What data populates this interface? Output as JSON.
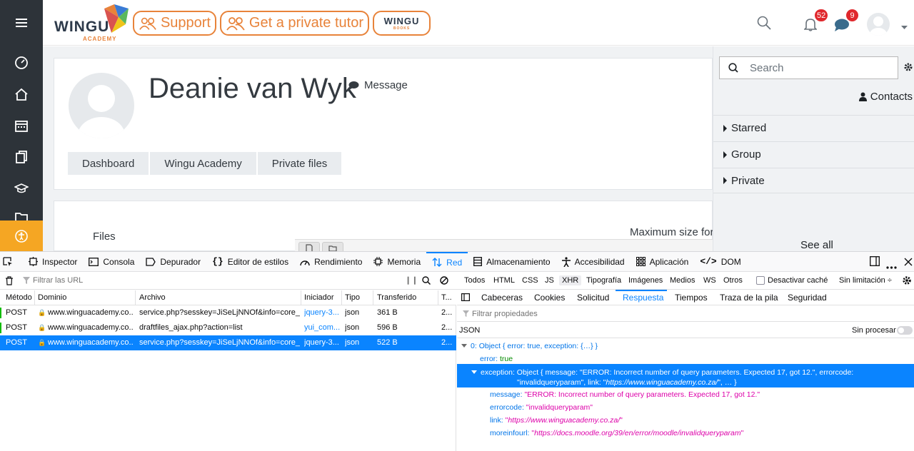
{
  "header": {
    "logo_text": "WINGU",
    "logo_sub": "ACADEMY",
    "support_label": "Support",
    "tutor_label": "Get a private tutor",
    "books_logo_text": "WINGU",
    "books_logo_sub": "BOOKS",
    "notifications_count": "52",
    "messages_count": "9"
  },
  "profile": {
    "name": "Deanie van Wyk",
    "message_label": "Message"
  },
  "breadcrumb": [
    "Dashboard",
    "Wingu Academy",
    "Private files"
  ],
  "files_section": {
    "label": "Files",
    "max_size_label": "Maximum size for"
  },
  "drawer": {
    "search_placeholder": "Search",
    "contacts_label": "Contacts",
    "sections": [
      "Starred",
      "Group",
      "Private"
    ],
    "see_all": "See all"
  },
  "devtools": {
    "tabs": [
      "Inspector",
      "Consola",
      "Depurador",
      "Editor de estilos",
      "Rendimiento",
      "Memoria",
      "Red",
      "Almacenamiento",
      "Accesibilidad",
      "Aplicación",
      "DOM"
    ],
    "active_tab": "Red",
    "filter_placeholder": "Filtrar las URL",
    "type_filters": [
      "Todos",
      "HTML",
      "CSS",
      "JS",
      "XHR",
      "Tipografía",
      "Imágenes",
      "Medios",
      "WS",
      "Otros"
    ],
    "active_type": "XHR",
    "disable_cache_label": "Desactivar caché",
    "throttle_label": "Sin limitación ÷",
    "columns": [
      "Método",
      "Dominio",
      "Archivo",
      "Iniciador",
      "Tipo",
      "Transferido",
      "T..."
    ],
    "requests": [
      {
        "method": "POST",
        "domain": "www.winguacademy.co....",
        "file": "service.php?sesskey=JiSeLjNNOf&info=core_fet",
        "initiator": "jquery-3...",
        "type": "json",
        "transferred": "361 B",
        "t": "2..."
      },
      {
        "method": "POST",
        "domain": "www.winguacademy.co....",
        "file": "draftfiles_ajax.php?action=list",
        "initiator": "yui_com...",
        "type": "json",
        "transferred": "596 B",
        "t": "2..."
      },
      {
        "method": "POST",
        "domain": "www.winguacademy.co....",
        "file": "service.php?sesskey=JiSeLjNNOf&info=core_me",
        "initiator": "jquery-3...",
        "type": "json",
        "transferred": "522 B",
        "t": "2..."
      }
    ],
    "detail_tabs": [
      "Cabeceras",
      "Cookies",
      "Solicitud",
      "Respuesta",
      "Tiempos",
      "Traza de la pila",
      "Seguridad"
    ],
    "active_detail_tab": "Respuesta",
    "prop_filter_placeholder": "Filtrar propiedades",
    "json_label": "JSON",
    "raw_label": "Sin procesar",
    "json": {
      "root_key": "0:",
      "root_val": "Object { error: true, exception: {…} }",
      "error_key": "error:",
      "error_val": "true",
      "exception_key": "exception:",
      "exception_val1": "Object { message: \"ERROR: Incorrect number of query parameters. Expected 17, got 12.\", errorcode:",
      "exception_val2_a": "\"invalidqueryparam\", link: \"",
      "exception_val2_link": "https://www.winguacademy.co.za/",
      "exception_val2_b": "\", … }",
      "message_key": "message:",
      "message_val": "\"ERROR: Incorrect number of query parameters. Expected 17, got 12.\"",
      "errorcode_key": "errorcode:",
      "errorcode_val": "\"invalidqueryparam\"",
      "link_key": "link:",
      "link_val": "https://www.winguacademy.co.za/",
      "moreinfo_key": "moreinfourl:",
      "moreinfo_val": "https://docs.moodle.org/39/en/error/moodle/invalidqueryparam"
    }
  },
  "colors": {
    "accent_orange": "#e8833a",
    "rail": "#2d3339",
    "devtools_blue": "#0a84ff",
    "badge_red": "#e0282d"
  }
}
